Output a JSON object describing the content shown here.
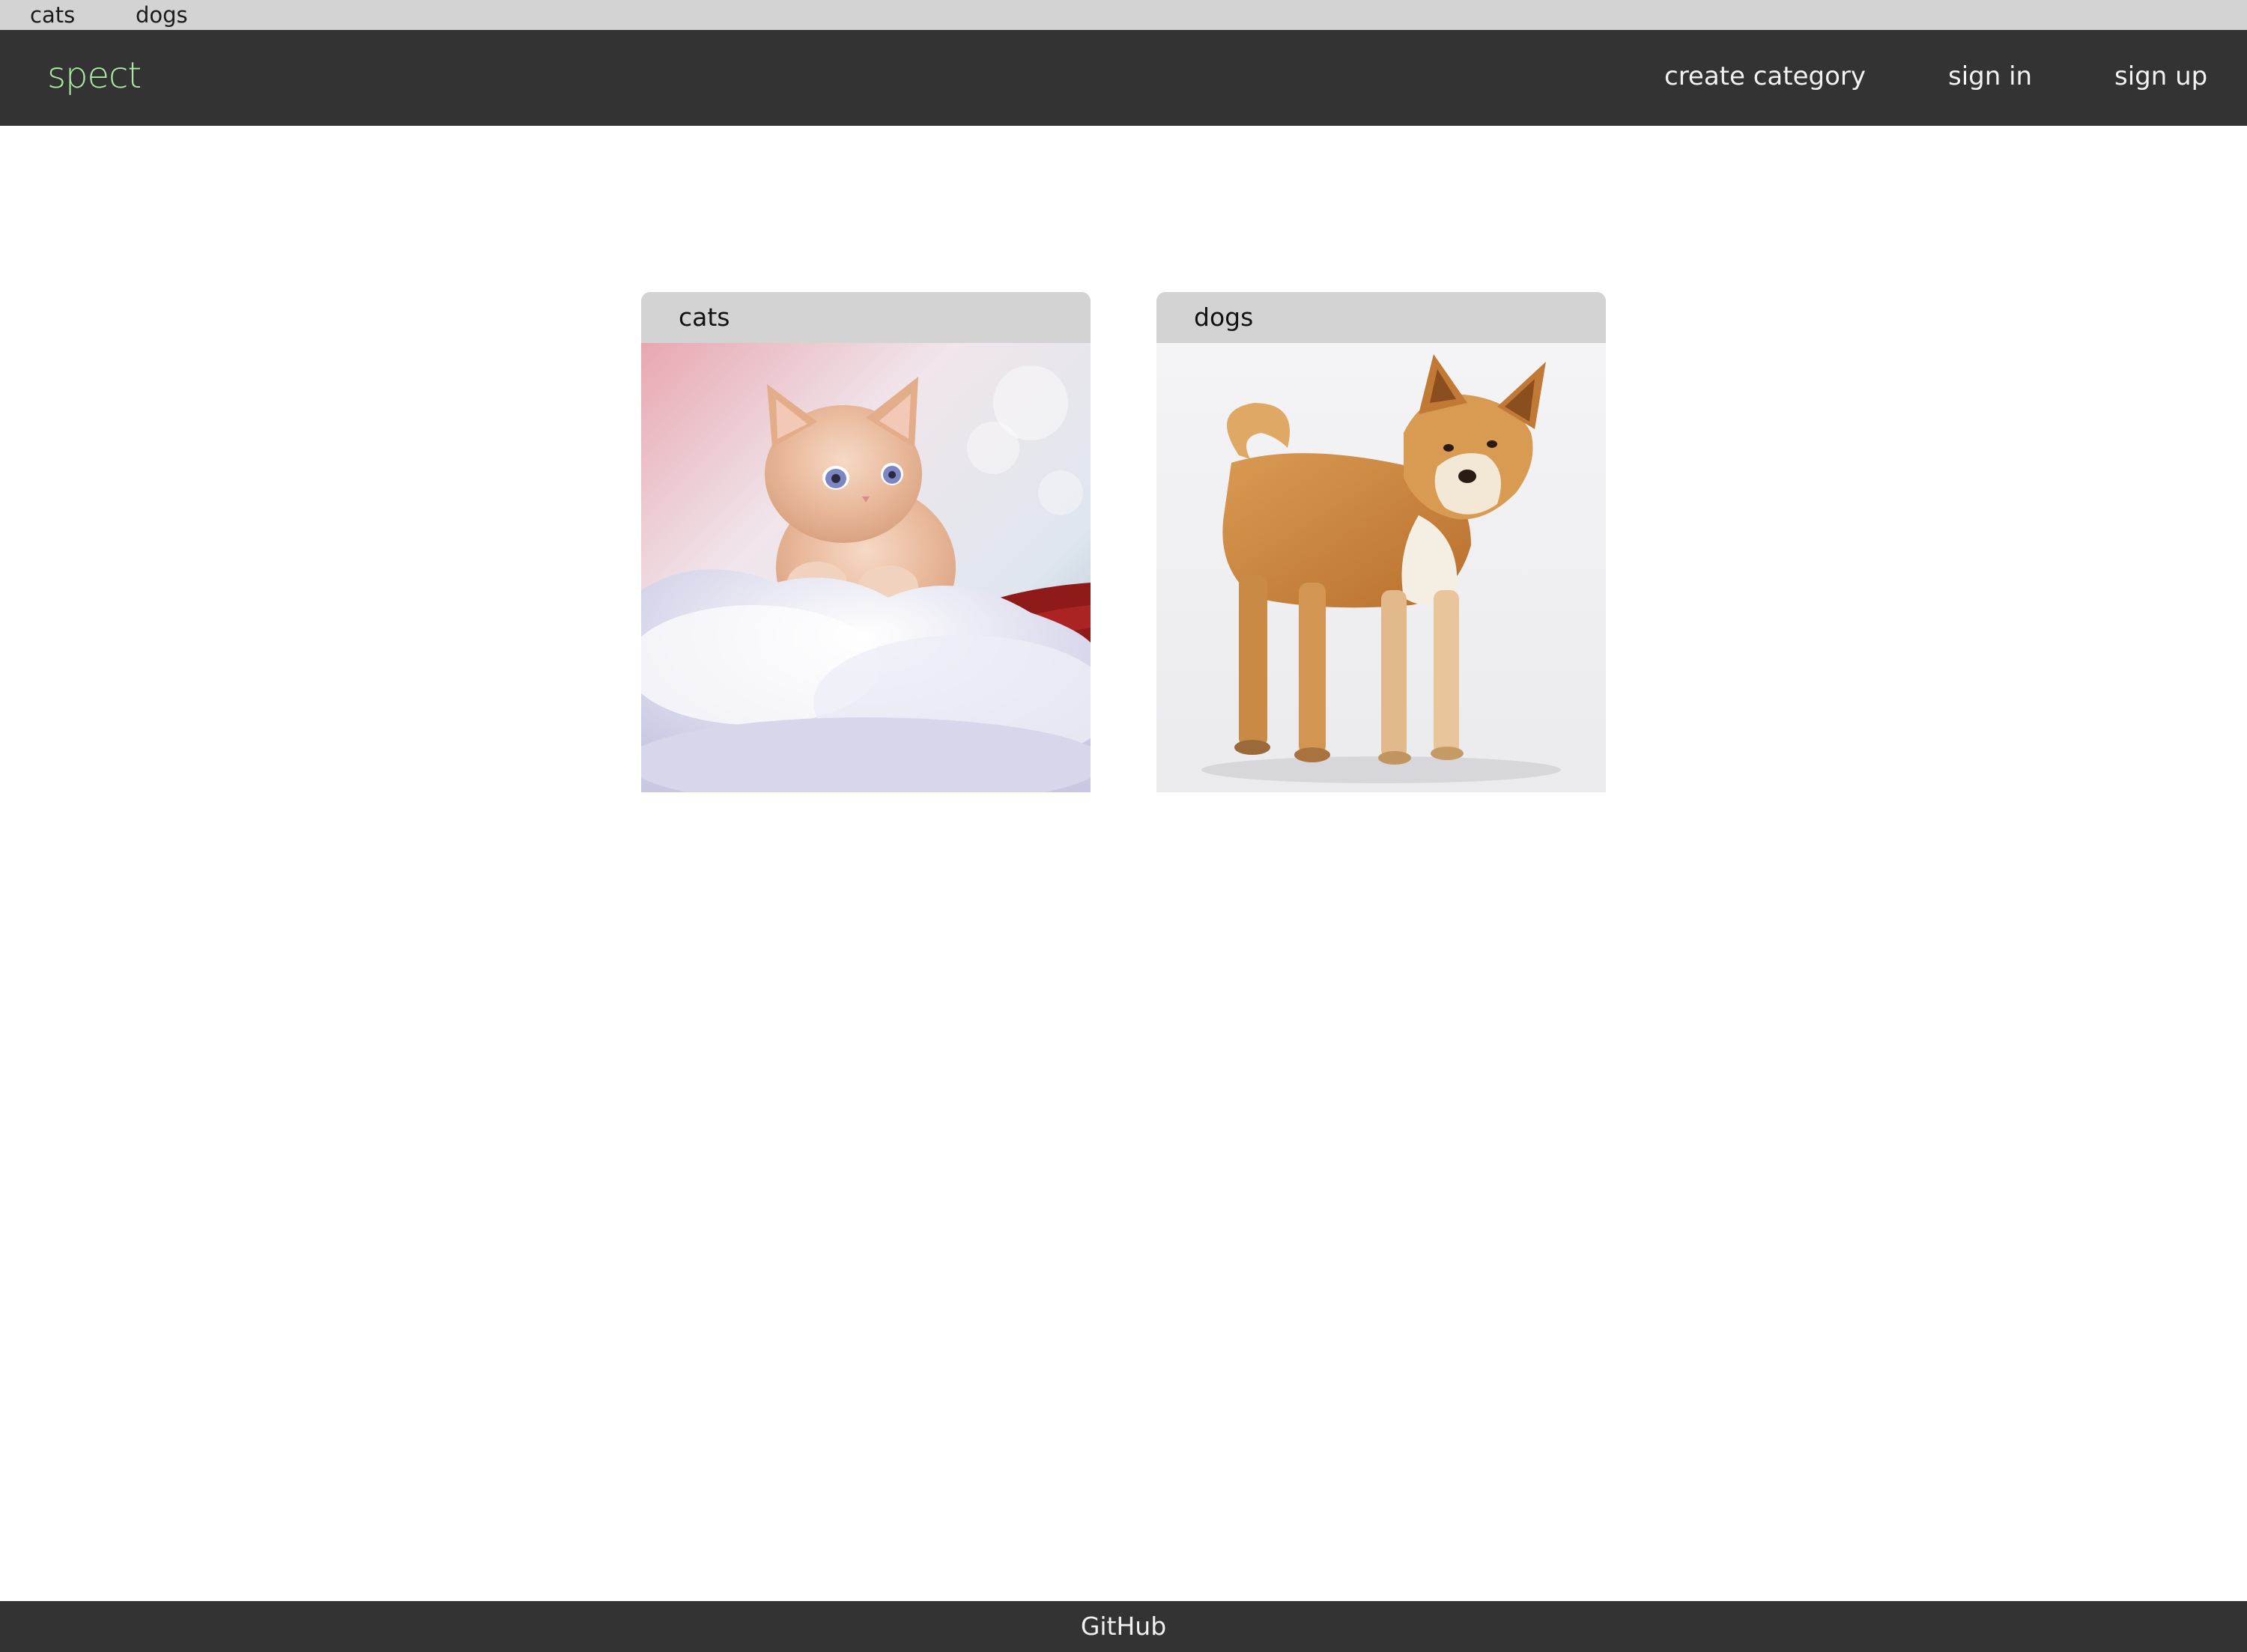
{
  "topbar": {
    "links": [
      "cats",
      "dogs"
    ]
  },
  "navbar": {
    "brand": "spect",
    "links": {
      "create_category": "create category",
      "sign_in": "sign in",
      "sign_up": "sign up"
    }
  },
  "categories": [
    {
      "title": "cats",
      "image": "kitten-photo"
    },
    {
      "title": "dogs",
      "image": "dog-photo"
    }
  ],
  "footer": {
    "link": "GitHub"
  },
  "colors": {
    "topbar": "#d3d3d3",
    "navbar": "#333333",
    "brand": "#a9e9a0",
    "card_header": "#d3d3d3",
    "footer": "#333333"
  }
}
